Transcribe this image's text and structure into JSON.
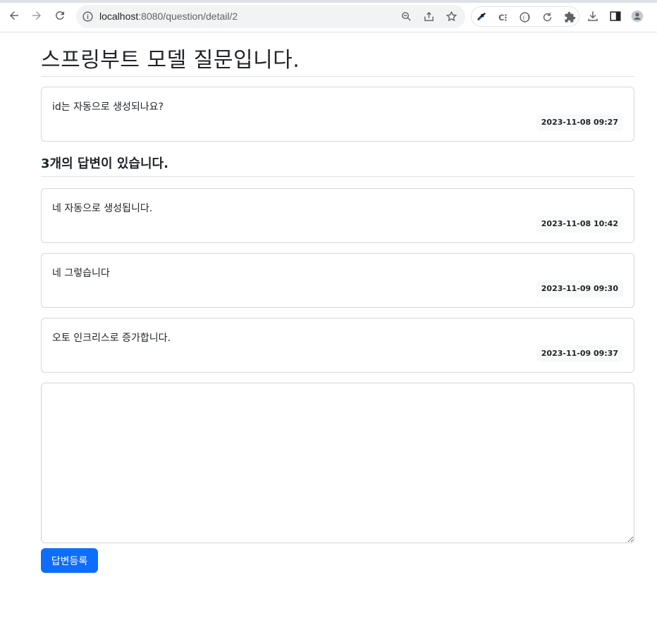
{
  "browser": {
    "url_host": "localhost",
    "url_rest": ":8080/question/detail/2"
  },
  "question": {
    "subject": "스프링부트 모델 질문입니다.",
    "content": "id는 자동으로 생성되나요?",
    "created": "2023-11-08 09:27"
  },
  "answer_count_text": "3개의 답변이 있습니다.",
  "answers": [
    {
      "content": "네 자동으로 생성됩니다.",
      "created": "2023-11-08 10:42"
    },
    {
      "content": "네 그렇습니다",
      "created": "2023-11-09 09:30"
    },
    {
      "content": "오토 인크리스로 증가합니다.",
      "created": "2023-11-09 09:37"
    }
  ],
  "form": {
    "content_value": "",
    "submit_label": "답변등록"
  }
}
